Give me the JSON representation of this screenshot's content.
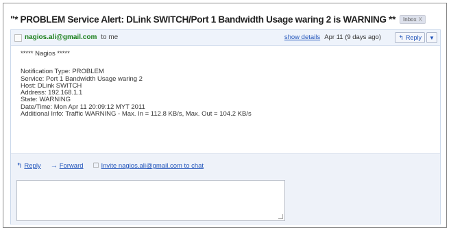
{
  "email": {
    "subject": "\"* PROBLEM Service Alert: DLink SWITCH/Port 1 Bandwidth Usage waring 2 is WARNING **",
    "label_chip": "Inbox",
    "label_chip_close": "X"
  },
  "message": {
    "sender": "nagios.ali@gmail.com",
    "recipient_text": "to me",
    "show_details": "show details",
    "date": "Apr 11 (9 days ago)",
    "reply_label": "Reply",
    "body": {
      "signature": "***** Nagios *****",
      "lines": [
        "Notification Type: PROBLEM",
        "Service: Port 1 Bandwidth Usage waring 2",
        "Host: DLink SWITCH",
        "Address: 192.168.1.1",
        "State: WARNING",
        "Date/Time: Mon Apr 11 20:09:12 MYT 2011",
        "Additional Info: Traffic WARNING - Max. In = 112.8 KB/s, Max. Out = 104.2 KB/s"
      ]
    }
  },
  "footer": {
    "reply": "Reply",
    "forward": "Forward",
    "invite": "Invite nagios.ali@gmail.com to chat"
  }
}
